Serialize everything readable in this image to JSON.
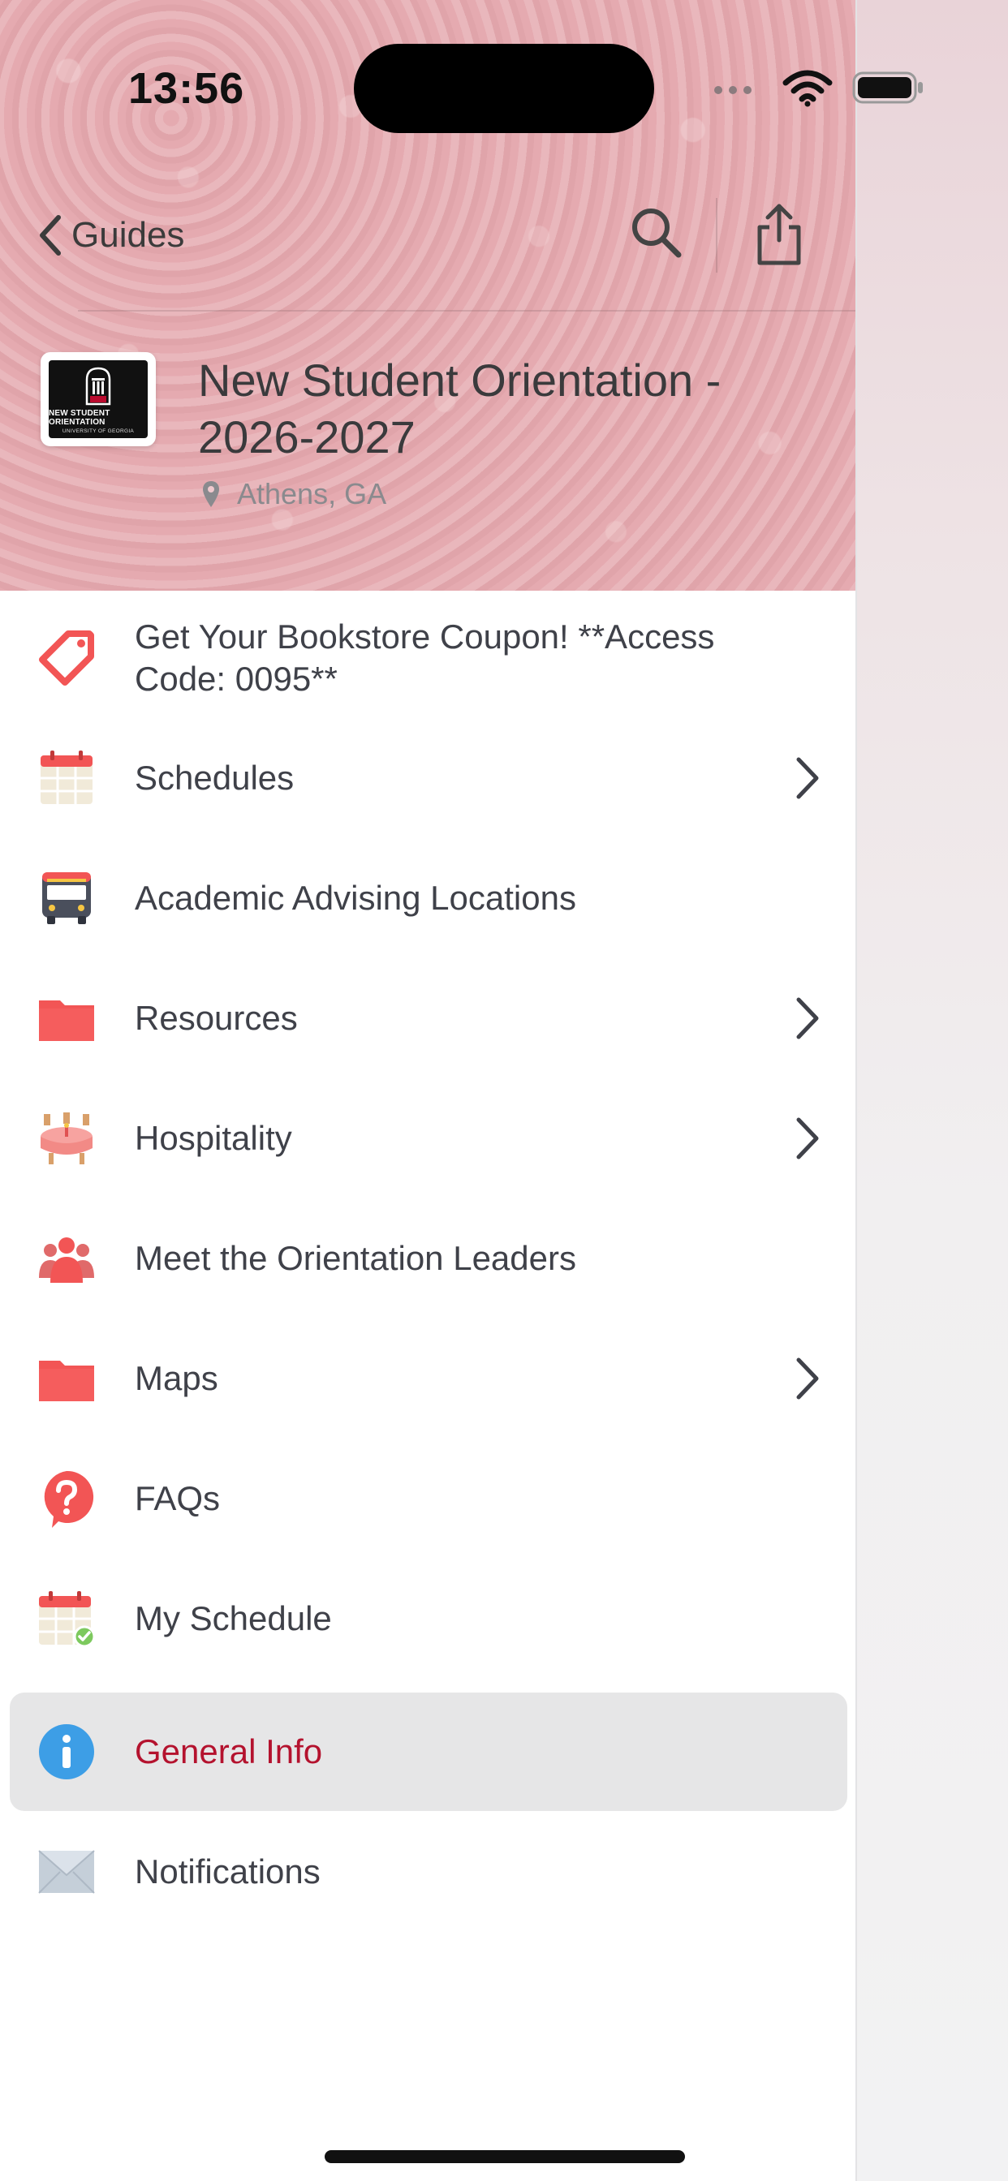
{
  "status_bar": {
    "time": "13:56"
  },
  "nav": {
    "back_label": "Guides"
  },
  "guide": {
    "title": "New Student Orientation - 2026-2027",
    "location": "Athens, GA",
    "logo_line1": "NEW STUDENT ORIENTATION",
    "logo_line2": "UNIVERSITY OF GEORGIA"
  },
  "menu": {
    "items": [
      {
        "label": "Get Your Bookstore Coupon! **Access Code: 0095**",
        "icon": "tag-icon",
        "has_chevron": false
      },
      {
        "label": "Schedules",
        "icon": "calendar-icon",
        "has_chevron": true
      },
      {
        "label": "Academic Advising Locations",
        "icon": "bus-icon",
        "has_chevron": false
      },
      {
        "label": "Resources",
        "icon": "folder-icon",
        "has_chevron": true
      },
      {
        "label": "Hospitality",
        "icon": "dining-table-icon",
        "has_chevron": true
      },
      {
        "label": "Meet the Orientation Leaders",
        "icon": "people-icon",
        "has_chevron": false
      },
      {
        "label": "Maps",
        "icon": "folder-icon",
        "has_chevron": true
      },
      {
        "label": "FAQs",
        "icon": "question-icon",
        "has_chevron": false
      },
      {
        "label": "My Schedule",
        "icon": "calendar-check-icon",
        "has_chevron": false
      },
      {
        "label": "General Info",
        "icon": "info-icon",
        "has_chevron": false,
        "selected": true
      },
      {
        "label": "Notifications",
        "icon": "envelope-icon",
        "has_chevron": false
      }
    ]
  },
  "colors": {
    "accent_red": "#b4122e",
    "icon_red": "#f25555",
    "info_blue": "#3d9ee6",
    "text": "#3f4149"
  }
}
